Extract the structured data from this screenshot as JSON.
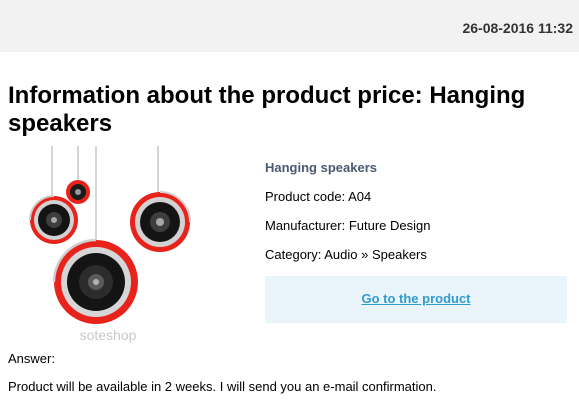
{
  "header": {
    "timestamp": "26-08-2016 11:32"
  },
  "page": {
    "title": "Information about the product price: Hanging speakers"
  },
  "product": {
    "name": "Hanging speakers",
    "code_line": "Product code: A04",
    "manufacturer_line": "Manufacturer: Future Design",
    "category_line": "Category: Audio » Speakers",
    "image_watermark": "soteshop"
  },
  "cta": {
    "label": "Go to the product"
  },
  "answer": {
    "label": "Answer:",
    "text": "Product will be available in 2 weeks. I will send you an e-mail confirmation."
  }
}
